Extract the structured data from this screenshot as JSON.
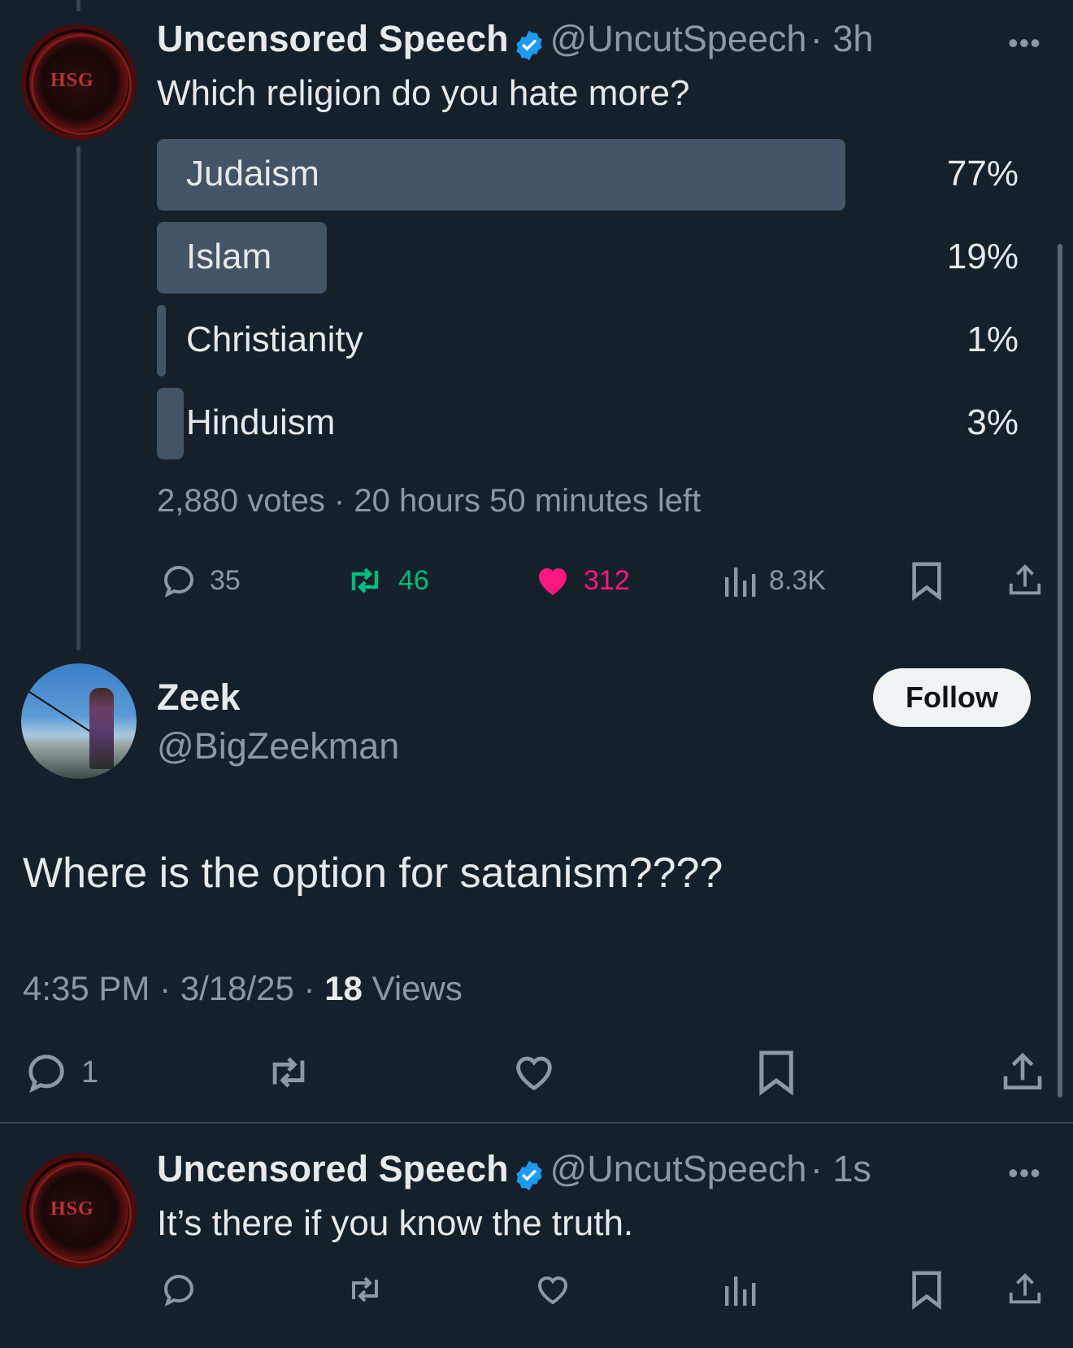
{
  "tweet1": {
    "name": "Uncensored Speech",
    "handle": "@UncutSpeech",
    "time": "· 3h",
    "text": "Which religion do you hate more?",
    "more": "•••",
    "poll": {
      "options": [
        {
          "label": "Judaism",
          "pct": "77%",
          "fraction": 0.77
        },
        {
          "label": "Islam",
          "pct": "19%",
          "fraction": 0.19
        },
        {
          "label": "Christianity",
          "pct": "1%",
          "fraction": 0.01
        },
        {
          "label": "Hinduism",
          "pct": "3%",
          "fraction": 0.03
        }
      ],
      "summary": "2,880 votes · 20 hours 50 minutes left"
    },
    "actions": {
      "replies": "35",
      "reposts": "46",
      "likes": "312",
      "views": "8.3K"
    },
    "avatar_text": "HSG"
  },
  "reply": {
    "name": "Zeek",
    "handle": "@BigZeekman",
    "follow_label": "Follow",
    "text": "Where is the option for satanism????",
    "timestamp": "4:35 PM · 3/18/25 · ",
    "views_count": "18",
    "views_label": " Views",
    "actions": {
      "replies": "1"
    }
  },
  "tweet3": {
    "name": "Uncensored Speech",
    "handle": "@UncutSpeech",
    "time": "· 1s",
    "text": "It’s there if you know the truth.",
    "more": "•••",
    "avatar_text": "HSG"
  },
  "colors": {
    "background": "#15202b",
    "poll_fill": "#425466",
    "repost_active": "#00ba7c",
    "like_active": "#f91880",
    "verified": "#1d9bf0",
    "muted": "#8b98a5"
  }
}
